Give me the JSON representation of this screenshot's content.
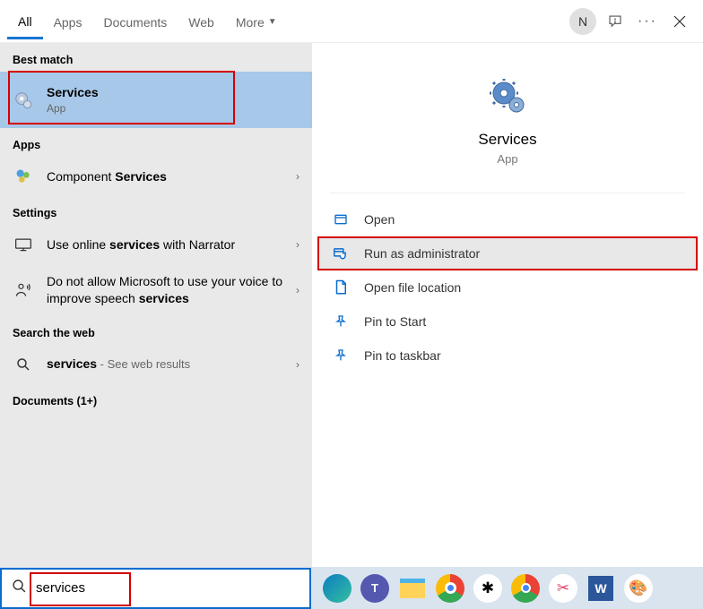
{
  "tabs": {
    "all": "All",
    "apps": "Apps",
    "documents": "Documents",
    "web": "Web",
    "more": "More"
  },
  "header": {
    "avatar_letter": "N"
  },
  "left": {
    "best_match": "Best match",
    "selected": {
      "title": "Services",
      "sub": "App"
    },
    "apps_label": "Apps",
    "component": {
      "prefix": "Component ",
      "bold": "Services"
    },
    "settings_label": "Settings",
    "setting1": {
      "prefix": "Use online ",
      "bold": "services",
      "suffix": " with Narrator"
    },
    "setting2": {
      "prefix": "Do not allow Microsoft to use your voice to improve speech ",
      "bold": "services"
    },
    "search_web_label": "Search the web",
    "web_result": {
      "bold": "services",
      "suffix": " - See web results"
    },
    "documents_label": "Documents (1+)"
  },
  "preview": {
    "title": "Services",
    "sub": "App",
    "actions": {
      "open": "Open",
      "run_admin": "Run as administrator",
      "open_loc": "Open file location",
      "pin_start": "Pin to Start",
      "pin_taskbar": "Pin to taskbar"
    }
  },
  "search": {
    "value": "services"
  }
}
